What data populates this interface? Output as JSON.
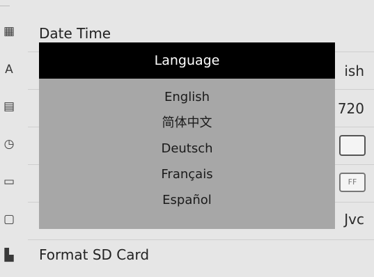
{
  "menu": {
    "items": [
      {
        "icon": "calendar-icon",
        "glyph": "▦",
        "label": "Date Time",
        "value": ""
      },
      {
        "icon": "text-language-icon",
        "glyph": "A",
        "label": "",
        "value": "ish"
      },
      {
        "icon": "film-resolution-icon",
        "glyph": "▤",
        "label": "",
        "value": "720"
      },
      {
        "icon": "clock-icon",
        "glyph": "◷",
        "label": "",
        "value": ""
      },
      {
        "icon": "ruler-icon",
        "glyph": "▭",
        "label": "",
        "value": "FF"
      },
      {
        "icon": "video-camera-icon",
        "glyph": "▢",
        "label": "",
        "value": "Jvc"
      },
      {
        "icon": "sd-card-icon",
        "glyph": "▙",
        "label": "Format SD Card",
        "value": ""
      }
    ]
  },
  "dialog": {
    "title": "Language",
    "options": [
      "English",
      "简体中文",
      "Deutsch",
      "Français",
      "Español"
    ]
  }
}
